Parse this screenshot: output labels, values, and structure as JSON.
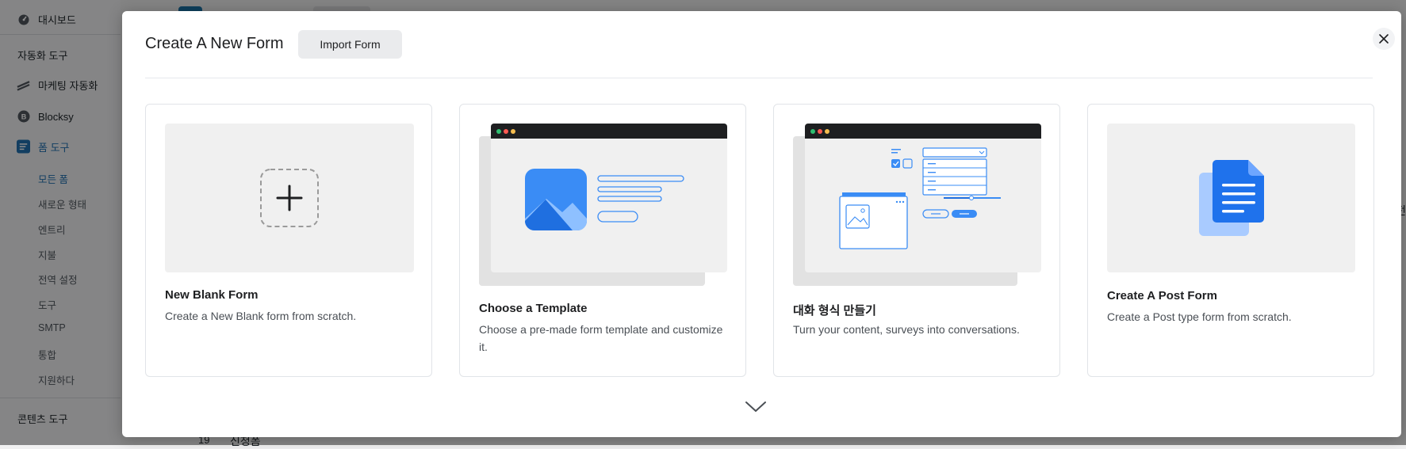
{
  "sidebar": {
    "dashboard": "대시보드",
    "automation_header": "자동화 도구",
    "marketing": "마케팅 자동화",
    "blocksy": "Blocksy",
    "form_tools": "폼 도구",
    "submenu": [
      "모든 폼",
      "새로운 형태",
      "엔트리",
      "지불",
      "전역 설정",
      "도구",
      "SMTP",
      "통합",
      "지원하다"
    ],
    "content_header": "콘텐츠 도구"
  },
  "background": {
    "row_number": "19",
    "row_title": "신청폼",
    "edge_char": "전"
  },
  "modal": {
    "title": "Create A New Form",
    "import_label": "Import Form",
    "cards": [
      {
        "title": "New Blank Form",
        "description": "Create a New Blank form from scratch."
      },
      {
        "title": "Choose a Template",
        "description": "Choose a pre-made form template and customize it."
      },
      {
        "title": "대화 형식 만들기",
        "description": "Turn your content, surveys into conversations."
      },
      {
        "title": "Create A Post Form",
        "description": "Create a Post type form from scratch."
      }
    ]
  },
  "icons": [
    "dashboard-icon",
    "marketing-icon",
    "blocksy-icon",
    "form-tools-icon",
    "close-icon",
    "plus-icon",
    "chevron-down-icon",
    "document-icon",
    "image-icon"
  ],
  "colors": {
    "accent": "#2271b1",
    "illustration_blue": "#3a8cf5",
    "window_bar": "#1e1f21"
  }
}
